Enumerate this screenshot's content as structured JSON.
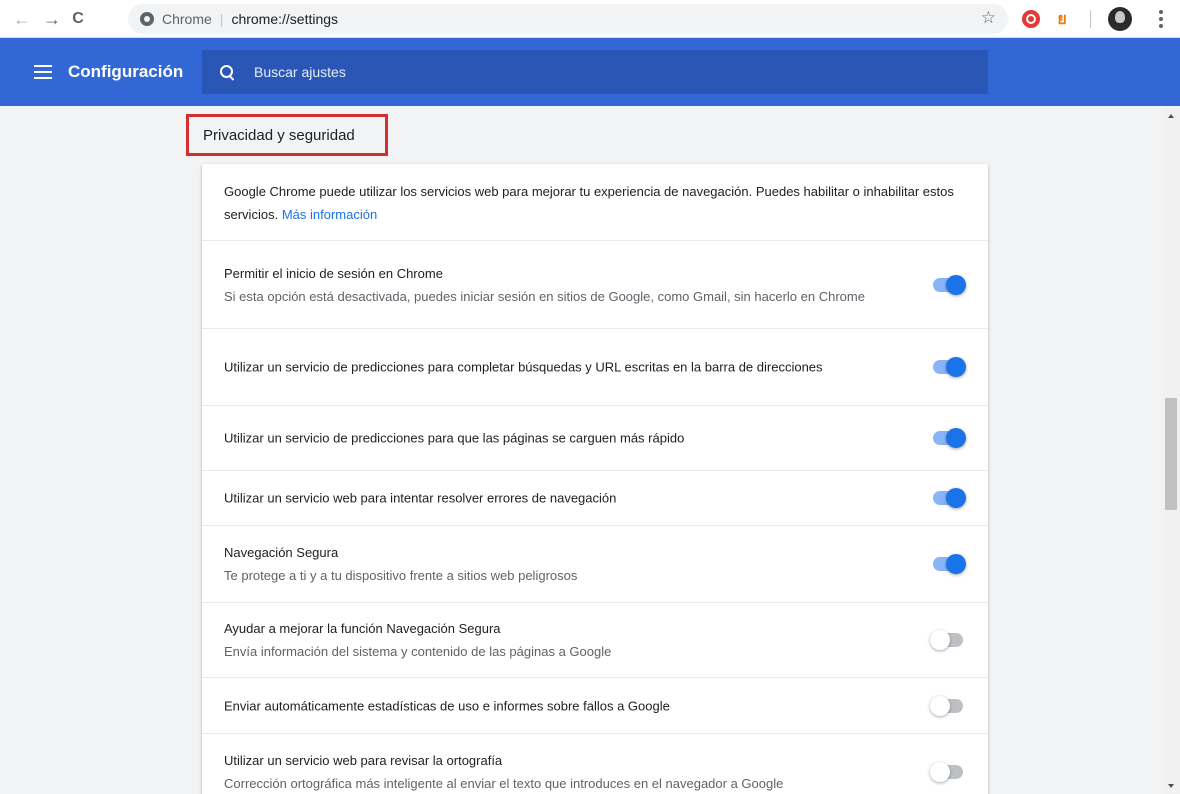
{
  "browser": {
    "chip_label": "Chrome",
    "url": "chrome://settings",
    "ext2_glyph": "ย"
  },
  "header": {
    "title": "Configuración",
    "search_placeholder": "Buscar ajustes"
  },
  "section": {
    "title": "Privacidad y seguridad"
  },
  "intro": {
    "text": "Google Chrome puede utilizar los servicios web para mejorar tu experiencia de navegación. Puedes habilitar o inhabilitar estos servicios.",
    "link": "Más información"
  },
  "settings": [
    {
      "title": "Permitir el inicio de sesión en Chrome",
      "subtitle": "Si esta opción está desactivada, puedes iniciar sesión en sitios de Google, como Gmail, sin hacerlo en Chrome",
      "enabled": true
    },
    {
      "title": "Utilizar un servicio de predicciones para completar búsquedas y URL escritas en la barra de direcciones",
      "subtitle": "",
      "enabled": true
    },
    {
      "title": "Utilizar un servicio de predicciones para que las páginas se carguen más rápido",
      "subtitle": "",
      "enabled": true
    },
    {
      "title": "Utilizar un servicio web para intentar resolver errores de navegación",
      "subtitle": "",
      "enabled": true
    },
    {
      "title": "Navegación Segura",
      "subtitle": "Te protege a ti y a tu dispositivo frente a sitios web peligrosos",
      "enabled": true
    },
    {
      "title": "Ayudar a mejorar la función Navegación Segura",
      "subtitle": "Envía información del sistema y contenido de las páginas a Google",
      "enabled": false
    },
    {
      "title": "Enviar automáticamente estadísticas de uso e informes sobre fallos a Google",
      "subtitle": "",
      "enabled": false
    },
    {
      "title": "Utilizar un servicio web para revisar la ortografía",
      "subtitle": "Corrección ortográfica más inteligente al enviar el texto que introduces en el navegador a Google",
      "enabled": false
    }
  ],
  "colors": {
    "header": "#3367d6",
    "toggle_on": "#1a73e8",
    "highlight_border": "#d32f2f"
  }
}
